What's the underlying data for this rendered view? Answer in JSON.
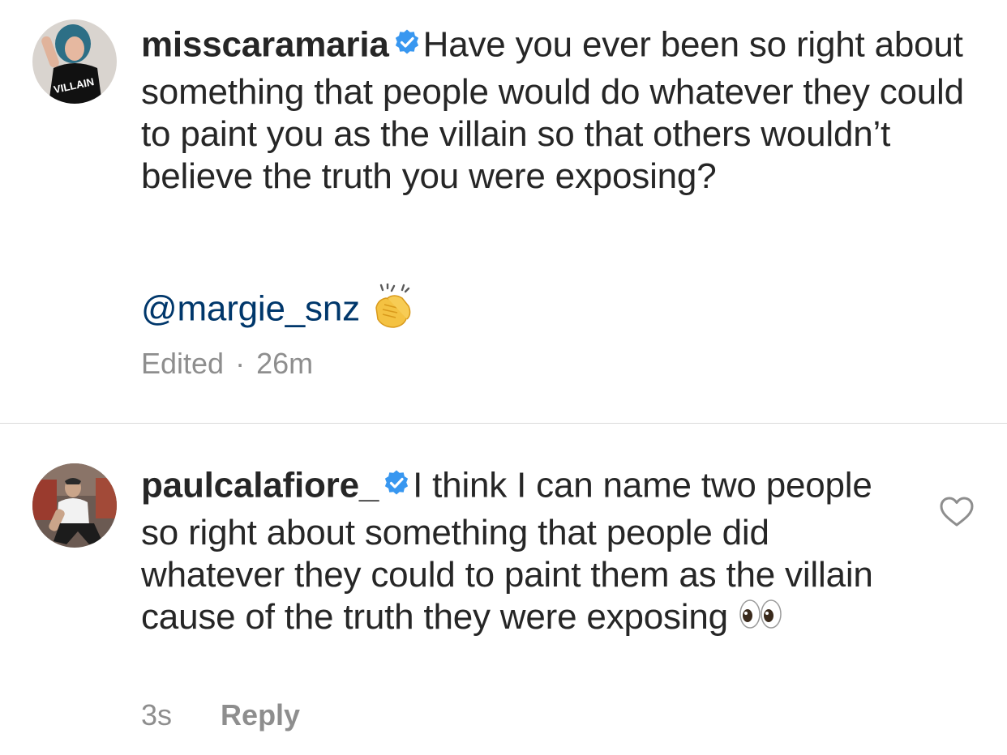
{
  "comments": [
    {
      "username": "misscaramaria",
      "text": "Have you ever been so right about something that people would do whatever they could to paint you as the villain so that others wouldn’t believe the truth you were exposing?",
      "mention": "@margie_snz",
      "emoji": "clapping-hands",
      "edited_label": "Edited",
      "separator": "·",
      "time": "26m",
      "avatar_shirt_text": "VILLAIN"
    },
    {
      "username": "paulcalafiore_",
      "text": "I think I can name two people so right about something that people did whatever they could to paint them as the villain cause of the truth they were exposing",
      "emoji": "eyes",
      "time": "3s",
      "reply_label": "Reply"
    }
  ],
  "colors": {
    "text": "#262626",
    "meta": "#8e8e8e",
    "mention": "#00376b",
    "verified": "#3897f0",
    "divider": "#dbdbdb"
  },
  "icons": [
    "verified-badge-icon",
    "heart-icon",
    "clapping-hands-emoji",
    "eyes-emoji"
  ]
}
